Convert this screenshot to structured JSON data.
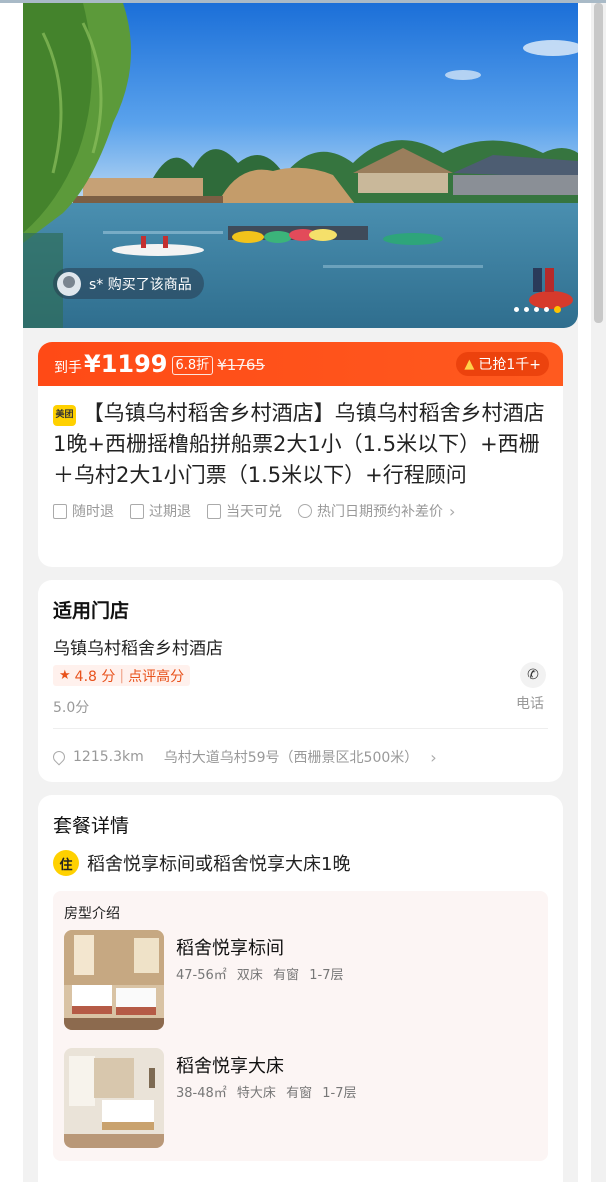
{
  "hero": {
    "buyer_text": "s* 购买了该商品",
    "slide_total": 5,
    "slide_active": 5
  },
  "price": {
    "prefix": "到手",
    "value": "¥1199",
    "discount": "6.8折",
    "original": "¥1765",
    "sold": "已抢1千+"
  },
  "product": {
    "brand_logo": "美团",
    "title": "【乌镇乌村稻舍乡村酒店】乌镇乌村稻舍乡村酒店1晚+西栅摇橹船拼船票2大1小（1.5米以下）+西栅＋乌村2大1小门票（1.5米以下）+行程顾问",
    "policies": [
      "随时退",
      "过期退",
      "当天可兑",
      "热门日期预约补差价"
    ]
  },
  "store": {
    "section_title": "适用门店",
    "name": "乌镇乌村稻舍乡村酒店",
    "rating": "4.8 分",
    "rating_tag": "点评高分",
    "score": "5.0分",
    "phone_label": "电话",
    "distance": "1215.3km",
    "address": "乌村大道乌村59号（西栅景区北500米）"
  },
  "package": {
    "title": "套餐详情",
    "stay_badge": "住",
    "stay_text": "稻舍悦享标间或稻舍悦享大床1晚",
    "room_intro": "房型介绍",
    "rooms": [
      {
        "name": "稻舍悦享标间",
        "area": "47-56㎡",
        "bed": "双床",
        "window": "有窗",
        "floor": "1-7层"
      },
      {
        "name": "稻舍悦享大床",
        "area": "38-48㎡",
        "bed": "特大床",
        "window": "有窗",
        "floor": "1-7层"
      }
    ]
  },
  "colors": {
    "price_bar": "#ff4a16",
    "accent_yellow": "#ffd100",
    "rating_red": "#e8521c"
  }
}
